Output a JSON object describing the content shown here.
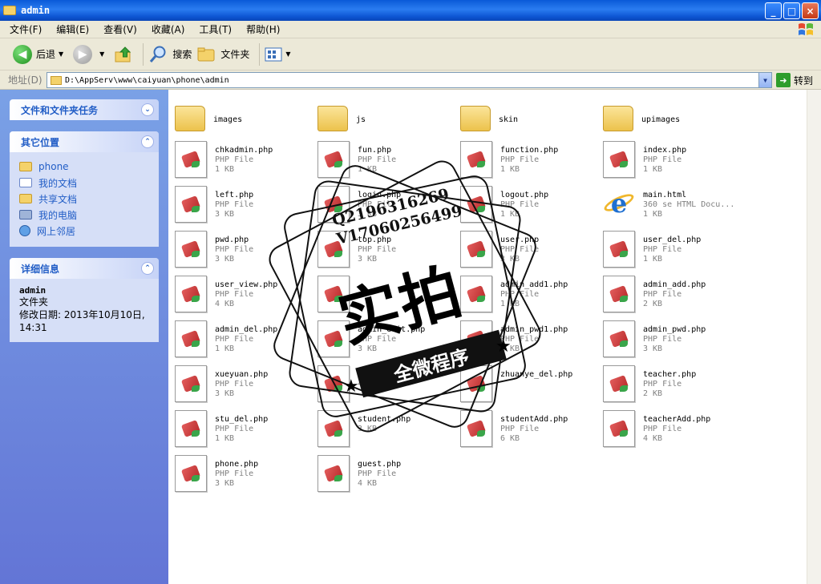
{
  "window": {
    "title": "admin",
    "buttons": {
      "minimize": "_",
      "maximize": "□",
      "close": "×"
    }
  },
  "menu": [
    "文件(F)",
    "编辑(E)",
    "查看(V)",
    "收藏(A)",
    "工具(T)",
    "帮助(H)"
  ],
  "toolbar": {
    "back_label": "后退",
    "search_label": "搜索",
    "folders_label": "文件夹"
  },
  "address": {
    "label": "地址(D)",
    "path": "D:\\AppServ\\www\\caiyuan\\phone\\admin",
    "go_label": "转到"
  },
  "taskpane": {
    "tasks_title": "文件和文件夹任务",
    "places_title": "其它位置",
    "places": [
      {
        "label": "phone",
        "icon": "folder-icon"
      },
      {
        "label": "我的文档",
        "icon": "my-documents-icon"
      },
      {
        "label": "共享文档",
        "icon": "folder-icon"
      },
      {
        "label": "我的电脑",
        "icon": "my-computer-icon"
      },
      {
        "label": "网上邻居",
        "icon": "network-icon"
      }
    ],
    "details_title": "详细信息",
    "details": {
      "name": "admin",
      "kind": "文件夹",
      "modified_label": "修改日期: 2013年10月10日,",
      "modified_time": "14:31"
    }
  },
  "files": [
    {
      "name": "images",
      "kind": "folder"
    },
    {
      "name": "js",
      "kind": "folder"
    },
    {
      "name": "skin",
      "kind": "folder"
    },
    {
      "name": "upimages",
      "kind": "folder"
    },
    {
      "name": "chkadmin.php",
      "type": "PHP File",
      "size": "1 KB",
      "kind": "php"
    },
    {
      "name": "fun.php",
      "type": "PHP File",
      "size": "1 KB",
      "kind": "php"
    },
    {
      "name": "function.php",
      "type": "PHP File",
      "size": "1 KB",
      "kind": "php"
    },
    {
      "name": "index.php",
      "type": "PHP File",
      "size": "1 KB",
      "kind": "php"
    },
    {
      "name": "left.php",
      "type": "PHP File",
      "size": "3 KB",
      "kind": "php"
    },
    {
      "name": "login.php",
      "type": "PHP File",
      "size": "3 KB",
      "kind": "php"
    },
    {
      "name": "logout.php",
      "type": "PHP File",
      "size": "1 KB",
      "kind": "php"
    },
    {
      "name": "main.html",
      "type": "360 se HTML Docu...",
      "size": "1 KB",
      "kind": "ie"
    },
    {
      "name": "pwd.php",
      "type": "PHP File",
      "size": "3 KB",
      "kind": "php"
    },
    {
      "name": "top.php",
      "type": "PHP File",
      "size": "3 KB",
      "kind": "php"
    },
    {
      "name": "user.php",
      "type": "PHP File",
      "size": "3 KB",
      "kind": "php"
    },
    {
      "name": "user_del.php",
      "type": "PHP File",
      "size": "1 KB",
      "kind": "php"
    },
    {
      "name": "user_view.php",
      "type": "PHP File",
      "size": "4 KB",
      "kind": "php"
    },
    {
      "name": "",
      "type": "",
      "size": "",
      "kind": "php"
    },
    {
      "name": "admin_add1.php",
      "type": "PHP File",
      "size": "1 KB",
      "kind": "php"
    },
    {
      "name": "admin_add.php",
      "type": "PHP File",
      "size": "2 KB",
      "kind": "php"
    },
    {
      "name": "admin_del.php",
      "type": "PHP File",
      "size": "1 KB",
      "kind": "php"
    },
    {
      "name": "admin_edit.php",
      "type": "PHP File",
      "size": "3 KB",
      "kind": "php"
    },
    {
      "name": "admin_pwd1.php",
      "type": "PHP File",
      "size": "1 KB",
      "kind": "php"
    },
    {
      "name": "admin_pwd.php",
      "type": "PHP File",
      "size": "3 KB",
      "kind": "php"
    },
    {
      "name": "xueyuan.php",
      "type": "PHP File",
      "size": "3 KB",
      "kind": "php"
    },
    {
      "name": "zh",
      "type": "",
      "size": "4",
      "kind": "php"
    },
    {
      "name": "zhuanye_del.php",
      "type": "",
      "size": "",
      "kind": "php"
    },
    {
      "name": "teacher.php",
      "type": "PHP File",
      "size": "2 KB",
      "kind": "php"
    },
    {
      "name": "stu_del.php",
      "type": "PHP File",
      "size": "1 KB",
      "kind": "php"
    },
    {
      "name": "student.php",
      "type": "",
      "size": "3 KB",
      "kind": "php"
    },
    {
      "name": "studentAdd.php",
      "type": "PHP File",
      "size": "6 KB",
      "kind": "php"
    },
    {
      "name": "teacherAdd.php",
      "type": "PHP File",
      "size": "4 KB",
      "kind": "php"
    },
    {
      "name": "phone.php",
      "type": "PHP File",
      "size": "3 KB",
      "kind": "php"
    },
    {
      "name": "guest.php",
      "type": "PHP File",
      "size": "4 KB",
      "kind": "php"
    }
  ],
  "watermark": {
    "line1": "Q2196316269",
    "line2": "V17060256499",
    "big": "实拍",
    "ribbon": "全微程序"
  }
}
